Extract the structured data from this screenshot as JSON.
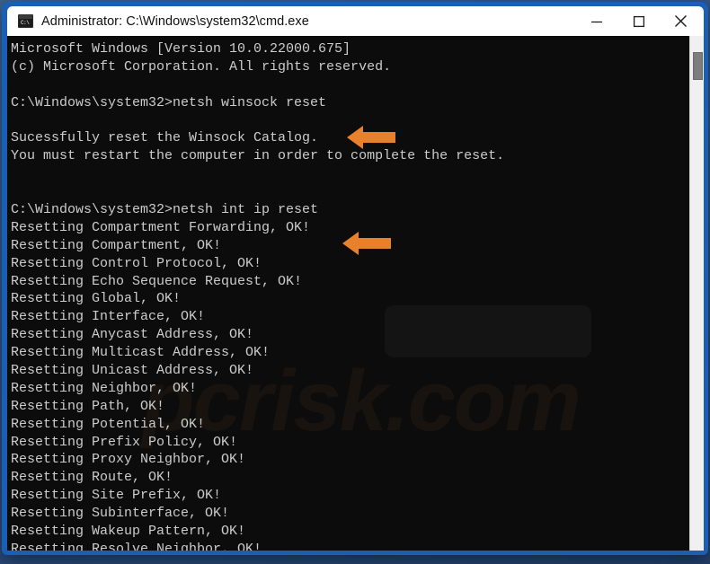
{
  "window": {
    "title": "Administrator: C:\\Windows\\system32\\cmd.exe",
    "icon": "cmd-console-icon",
    "prompt_glyph": "C:\\",
    "controls": {
      "minimize": "Minimize",
      "maximize": "Maximize",
      "close": "Close"
    }
  },
  "console": {
    "watermark": "pcrisk.com",
    "lines": [
      "Microsoft Windows [Version 10.0.22000.675]",
      "(c) Microsoft Corporation. All rights reserved.",
      "",
      "C:\\Windows\\system32>netsh winsock reset",
      "",
      "Sucessfully reset the Winsock Catalog.",
      "You must restart the computer in order to complete the reset.",
      "",
      "",
      "C:\\Windows\\system32>netsh int ip reset",
      "Resetting Compartment Forwarding, OK!",
      "Resetting Compartment, OK!",
      "Resetting Control Protocol, OK!",
      "Resetting Echo Sequence Request, OK!",
      "Resetting Global, OK!",
      "Resetting Interface, OK!",
      "Resetting Anycast Address, OK!",
      "Resetting Multicast Address, OK!",
      "Resetting Unicast Address, OK!",
      "Resetting Neighbor, OK!",
      "Resetting Path, OK!",
      "Resetting Potential, OK!",
      "Resetting Prefix Policy, OK!",
      "Resetting Proxy Neighbor, OK!",
      "Resetting Route, OK!",
      "Resetting Site Prefix, OK!",
      "Resetting Subinterface, OK!",
      "Resetting Wakeup Pattern, OK!",
      "Resetting Resolve Neighbor, OK!"
    ]
  },
  "annotations": [
    {
      "name": "arrow-winsock",
      "points_to": "netsh winsock reset",
      "color": "#E8812C"
    },
    {
      "name": "arrow-int-ip",
      "points_to": "netsh int ip reset",
      "color": "#E8812C"
    }
  ],
  "colors": {
    "window_border": "#1a5fb4",
    "title_bar": "#ffffff",
    "console_background": "#0c0c0c",
    "console_text": "#cccccc",
    "arrow": "#E8812C",
    "scrollbar_thumb": "#7d7d7d"
  }
}
